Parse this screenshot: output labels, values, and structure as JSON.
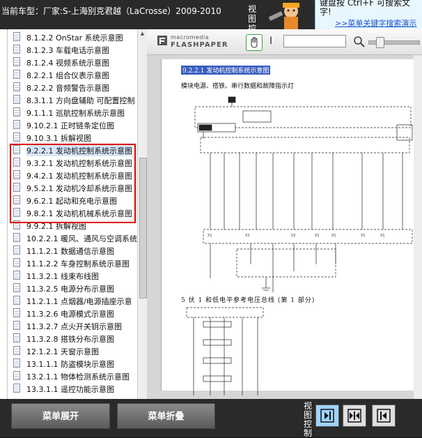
{
  "header": {
    "car_label": "当前车型：厂家:S-上海别克君越（LaCrosse）2009-2010",
    "view_text": "视图控制",
    "tip_line1": "键盘按 Ctrl+F 可搜索文",
    "tip_line2": "字!",
    "tip_link": ">>菜单关键字搜索演示"
  },
  "sidebar": {
    "items": [
      {
        "label": "8.1.2.2 OnStar 系统示意图"
      },
      {
        "label": "8.1.2.3 车载电话示意图"
      },
      {
        "label": "8.1.2.4 视频系统示意图"
      },
      {
        "label": "8.2.2.1 组合仪表示意图"
      },
      {
        "label": "8.2.2.2 音频警告示意图"
      },
      {
        "label": "8.3.1.1 方向盘辅助 可配置控制"
      },
      {
        "label": "9.1.1.1 巡航控制系统示意图"
      },
      {
        "label": "9.10.2.1 正时链条定位图"
      },
      {
        "label": "9.10.3.1 拆解视图"
      },
      {
        "label": "9.2.2.1 发动机控制系统示意图"
      },
      {
        "label": "9.3.2.1 发动机控制系统示意图"
      },
      {
        "label": "9.4.2.1 发动机控制系统示意图"
      },
      {
        "label": "9.5.2.1 发动机冷却系统示意图"
      },
      {
        "label": "9.6.2.1 起动和充电示意图"
      },
      {
        "label": "9.8.2.1 发动机机械系统示意图"
      },
      {
        "label": "9.9.2.1 拆解视图"
      },
      {
        "label": "10.2.2.1 暖风、通风与空调系统"
      },
      {
        "label": "11.1.2.1 数据通信示意图"
      },
      {
        "label": "11.1.2.2 车身控制系统示意图"
      },
      {
        "label": "11.3.2.1 线束布线图"
      },
      {
        "label": "11.3.2.5 电源分布示意图"
      },
      {
        "label": "11.2.1.1 点烟器/电源插座示意"
      },
      {
        "label": "11.3.2.6 电源模式示意图"
      },
      {
        "label": "11.3.2.7 点火开关钥示意图"
      },
      {
        "label": "11.3.2.8 搭铁分布示意图"
      },
      {
        "label": "12.1.2.1 天窗示意图"
      },
      {
        "label": "13.1.1.1 防盗模块示意图"
      },
      {
        "label": "13.2.1.1 物体检测系统示意图"
      },
      {
        "label": "13.3.1.1 遥控功能示意图"
      }
    ],
    "selected_index": 9
  },
  "viewer": {
    "brand_top": "macromedia",
    "brand_main": "FLASHPAPER",
    "text_tool": "I",
    "find_value": "",
    "page_title": "9.2.2.1 发动机控制系统示意图",
    "page_caption": "模块电源、搭铁、串行数据和故障指示灯",
    "page_caption2": "5 伏 1 和低电平参考电压总线 (第 1 部分)"
  },
  "footer": {
    "expand_label": "菜单展开",
    "collapse_label": "菜单折叠",
    "view_ctrl_label": "视图控制"
  },
  "colors": {
    "highlight": "#e00000",
    "selection": "#3b5fbf",
    "link": "#1a55c8"
  }
}
